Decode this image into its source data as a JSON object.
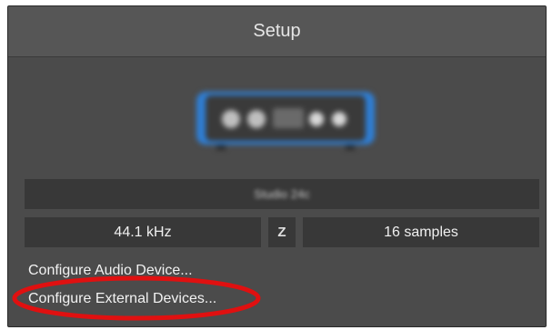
{
  "window": {
    "title": "Setup"
  },
  "device": {
    "name": "Studio 24c",
    "image_icon": "audio-interface-icon"
  },
  "settings": {
    "sample_rate": "44.1 kHz",
    "zero_latency_icon": "z-latency-icon",
    "buffer_size": "16 samples"
  },
  "links": {
    "configure_audio": "Configure Audio Device...",
    "configure_external": "Configure External Devices..."
  },
  "colors": {
    "panel_bg": "#4b4b4b",
    "field_bg": "#383838",
    "annotation": "#e01010",
    "device_accent": "#2f7fd6"
  }
}
